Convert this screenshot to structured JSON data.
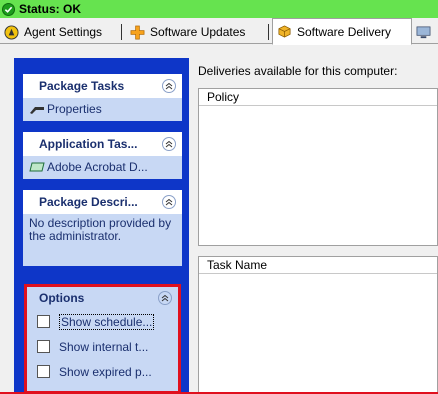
{
  "status": {
    "text": "Status: OK",
    "color": "#66e34f"
  },
  "tabs": [
    {
      "label": "Agent Settings",
      "icon": "agent-settings-icon"
    },
    {
      "label": "Software Updates",
      "icon": "software-updates-icon"
    },
    {
      "label": "Software Delivery",
      "icon": "software-delivery-icon",
      "active": true
    }
  ],
  "left_panel": {
    "package_tasks": {
      "title": "Package Tasks",
      "items": [
        "Properties"
      ]
    },
    "application_tasks": {
      "title": "Application Tas...",
      "items": [
        "Adobe Acrobat D..."
      ]
    },
    "package_description": {
      "title": "Package Descri...",
      "text": "No description provided by the administrator."
    },
    "options": {
      "title": "Options",
      "items": [
        "Show schedule...",
        "Show internal t...",
        "Show expired p..."
      ]
    }
  },
  "main": {
    "deliveries_label": "Deliveries available for this computer:",
    "policy_column": "Policy",
    "task_column": "Task Name"
  },
  "colors": {
    "panel_bg": "#0e36c8",
    "highlight_border": "#e0101e"
  }
}
